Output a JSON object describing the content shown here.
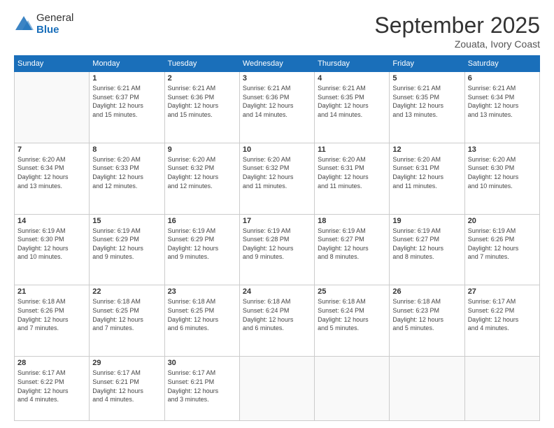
{
  "logo": {
    "general": "General",
    "blue": "Blue"
  },
  "header": {
    "month": "September 2025",
    "location": "Zouata, Ivory Coast"
  },
  "weekdays": [
    "Sunday",
    "Monday",
    "Tuesday",
    "Wednesday",
    "Thursday",
    "Friday",
    "Saturday"
  ],
  "weeks": [
    [
      {
        "day": "",
        "info": ""
      },
      {
        "day": "1",
        "info": "Sunrise: 6:21 AM\nSunset: 6:37 PM\nDaylight: 12 hours\nand 15 minutes."
      },
      {
        "day": "2",
        "info": "Sunrise: 6:21 AM\nSunset: 6:36 PM\nDaylight: 12 hours\nand 15 minutes."
      },
      {
        "day": "3",
        "info": "Sunrise: 6:21 AM\nSunset: 6:36 PM\nDaylight: 12 hours\nand 14 minutes."
      },
      {
        "day": "4",
        "info": "Sunrise: 6:21 AM\nSunset: 6:35 PM\nDaylight: 12 hours\nand 14 minutes."
      },
      {
        "day": "5",
        "info": "Sunrise: 6:21 AM\nSunset: 6:35 PM\nDaylight: 12 hours\nand 13 minutes."
      },
      {
        "day": "6",
        "info": "Sunrise: 6:21 AM\nSunset: 6:34 PM\nDaylight: 12 hours\nand 13 minutes."
      }
    ],
    [
      {
        "day": "7",
        "info": "Sunrise: 6:20 AM\nSunset: 6:34 PM\nDaylight: 12 hours\nand 13 minutes."
      },
      {
        "day": "8",
        "info": "Sunrise: 6:20 AM\nSunset: 6:33 PM\nDaylight: 12 hours\nand 12 minutes."
      },
      {
        "day": "9",
        "info": "Sunrise: 6:20 AM\nSunset: 6:32 PM\nDaylight: 12 hours\nand 12 minutes."
      },
      {
        "day": "10",
        "info": "Sunrise: 6:20 AM\nSunset: 6:32 PM\nDaylight: 12 hours\nand 11 minutes."
      },
      {
        "day": "11",
        "info": "Sunrise: 6:20 AM\nSunset: 6:31 PM\nDaylight: 12 hours\nand 11 minutes."
      },
      {
        "day": "12",
        "info": "Sunrise: 6:20 AM\nSunset: 6:31 PM\nDaylight: 12 hours\nand 11 minutes."
      },
      {
        "day": "13",
        "info": "Sunrise: 6:20 AM\nSunset: 6:30 PM\nDaylight: 12 hours\nand 10 minutes."
      }
    ],
    [
      {
        "day": "14",
        "info": "Sunrise: 6:19 AM\nSunset: 6:30 PM\nDaylight: 12 hours\nand 10 minutes."
      },
      {
        "day": "15",
        "info": "Sunrise: 6:19 AM\nSunset: 6:29 PM\nDaylight: 12 hours\nand 9 minutes."
      },
      {
        "day": "16",
        "info": "Sunrise: 6:19 AM\nSunset: 6:29 PM\nDaylight: 12 hours\nand 9 minutes."
      },
      {
        "day": "17",
        "info": "Sunrise: 6:19 AM\nSunset: 6:28 PM\nDaylight: 12 hours\nand 9 minutes."
      },
      {
        "day": "18",
        "info": "Sunrise: 6:19 AM\nSunset: 6:27 PM\nDaylight: 12 hours\nand 8 minutes."
      },
      {
        "day": "19",
        "info": "Sunrise: 6:19 AM\nSunset: 6:27 PM\nDaylight: 12 hours\nand 8 minutes."
      },
      {
        "day": "20",
        "info": "Sunrise: 6:19 AM\nSunset: 6:26 PM\nDaylight: 12 hours\nand 7 minutes."
      }
    ],
    [
      {
        "day": "21",
        "info": "Sunrise: 6:18 AM\nSunset: 6:26 PM\nDaylight: 12 hours\nand 7 minutes."
      },
      {
        "day": "22",
        "info": "Sunrise: 6:18 AM\nSunset: 6:25 PM\nDaylight: 12 hours\nand 7 minutes."
      },
      {
        "day": "23",
        "info": "Sunrise: 6:18 AM\nSunset: 6:25 PM\nDaylight: 12 hours\nand 6 minutes."
      },
      {
        "day": "24",
        "info": "Sunrise: 6:18 AM\nSunset: 6:24 PM\nDaylight: 12 hours\nand 6 minutes."
      },
      {
        "day": "25",
        "info": "Sunrise: 6:18 AM\nSunset: 6:24 PM\nDaylight: 12 hours\nand 5 minutes."
      },
      {
        "day": "26",
        "info": "Sunrise: 6:18 AM\nSunset: 6:23 PM\nDaylight: 12 hours\nand 5 minutes."
      },
      {
        "day": "27",
        "info": "Sunrise: 6:17 AM\nSunset: 6:22 PM\nDaylight: 12 hours\nand 4 minutes."
      }
    ],
    [
      {
        "day": "28",
        "info": "Sunrise: 6:17 AM\nSunset: 6:22 PM\nDaylight: 12 hours\nand 4 minutes."
      },
      {
        "day": "29",
        "info": "Sunrise: 6:17 AM\nSunset: 6:21 PM\nDaylight: 12 hours\nand 4 minutes."
      },
      {
        "day": "30",
        "info": "Sunrise: 6:17 AM\nSunset: 6:21 PM\nDaylight: 12 hours\nand 3 minutes."
      },
      {
        "day": "",
        "info": ""
      },
      {
        "day": "",
        "info": ""
      },
      {
        "day": "",
        "info": ""
      },
      {
        "day": "",
        "info": ""
      }
    ]
  ]
}
